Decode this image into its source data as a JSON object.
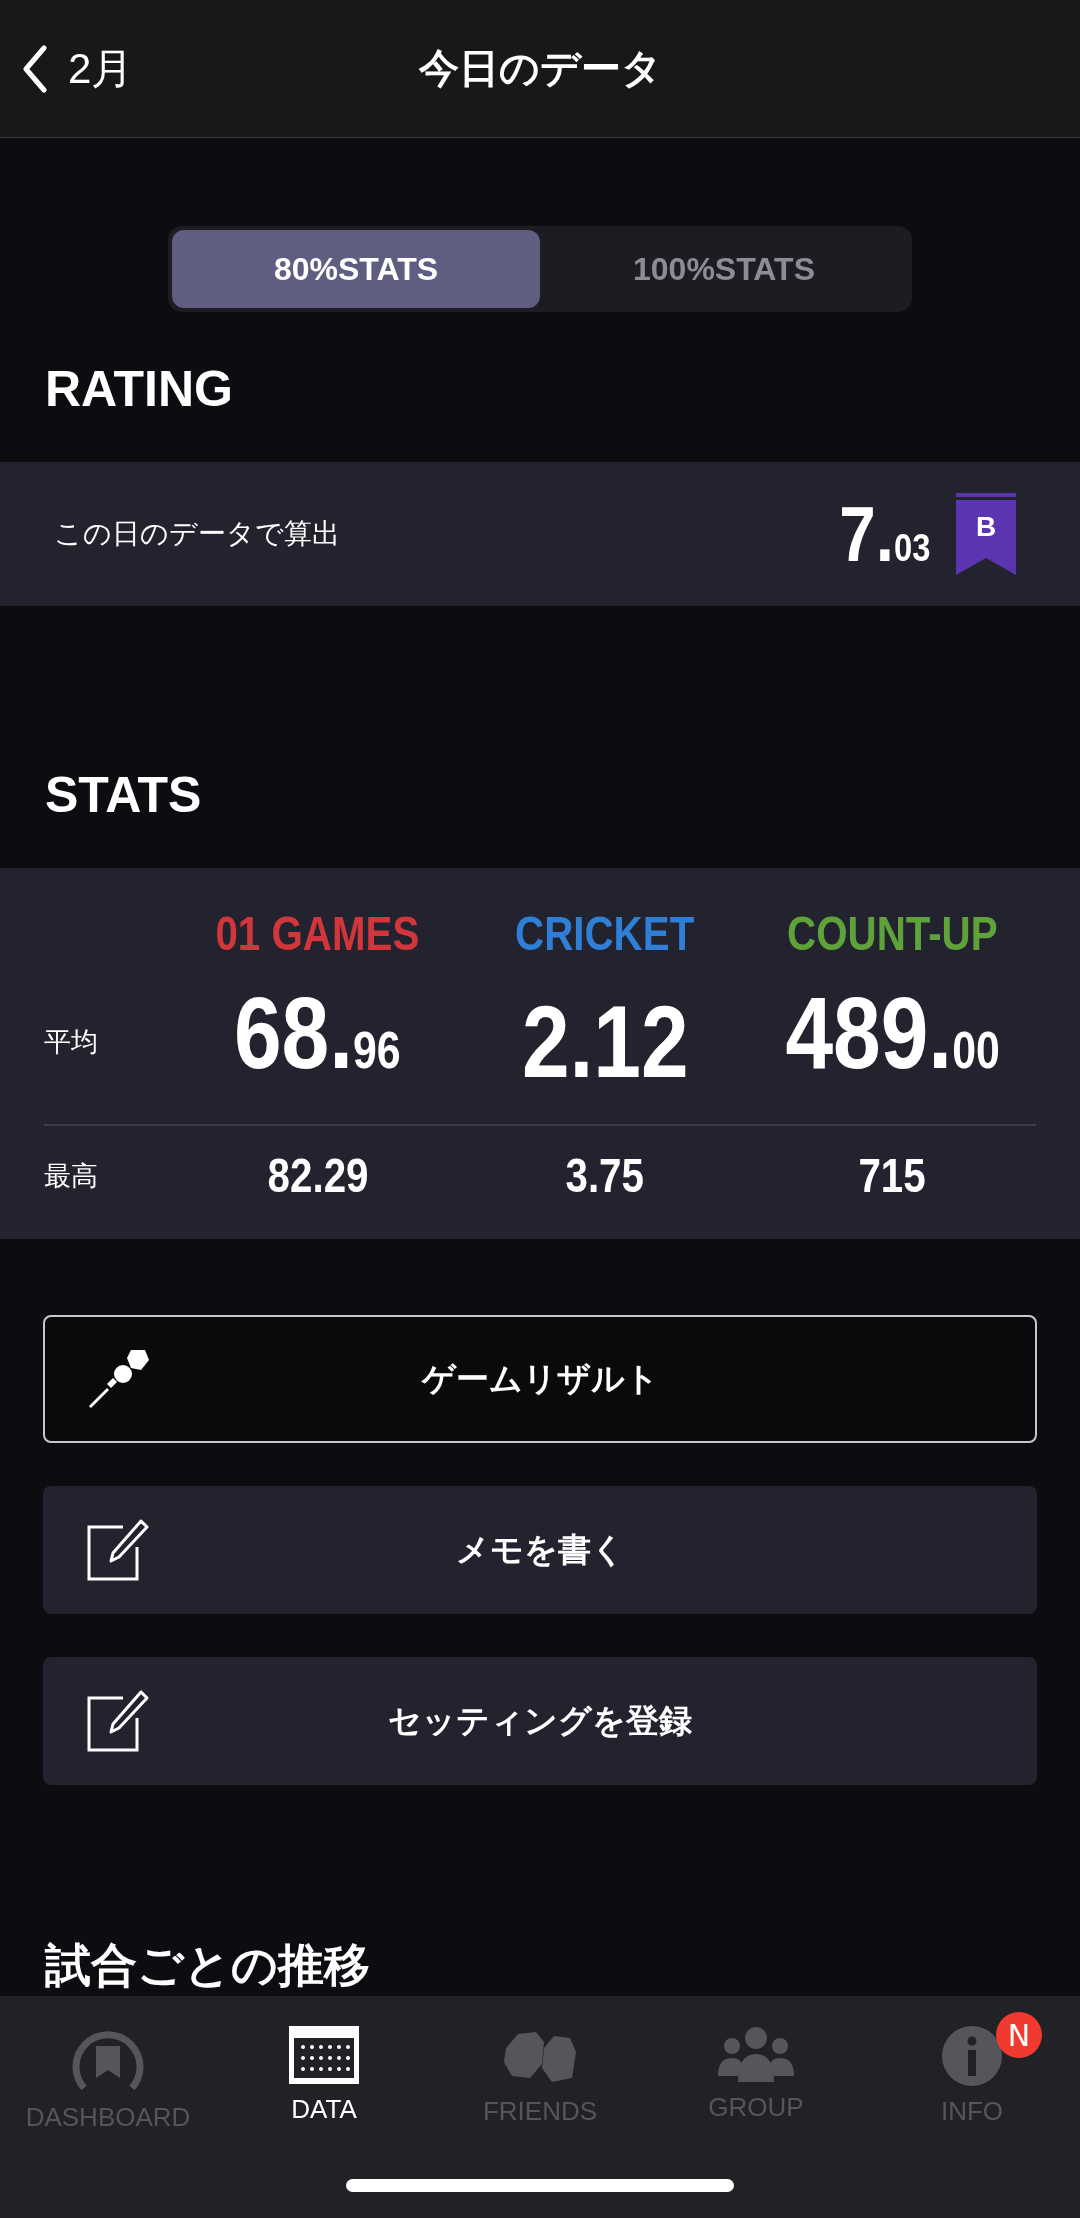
{
  "header": {
    "back_label": "2月",
    "title": "今日のデータ"
  },
  "stats_toggle": [
    {
      "label": "80%STATS",
      "selected": true
    },
    {
      "label": "100%STATS",
      "selected": false
    }
  ],
  "rating": {
    "heading": "RATING",
    "caption": "この日のデータで算出",
    "value_main": "7.",
    "value_fraction": "03",
    "rank": "B"
  },
  "stats": {
    "heading": "STATS",
    "row_labels": [
      "平均",
      "最高"
    ],
    "columns": [
      {
        "name": "01 GAMES",
        "color": "#d0363a",
        "average_main": "68.",
        "average_fraction": "96",
        "best": "82.29"
      },
      {
        "name": "CRICKET",
        "color": "#2f7fd6",
        "average_main": "2.12",
        "best": "3.75"
      },
      {
        "name": "COUNT-UP",
        "color": "#5fa23a",
        "average_main": "489.",
        "average_fraction": "00",
        "best": "715"
      }
    ]
  },
  "actions": [
    {
      "label": "ゲームリザルト",
      "kind": "outlined"
    },
    {
      "label": "メモを書く",
      "kind": "filled"
    },
    {
      "label": "セッティングを登録",
      "kind": "filled"
    }
  ],
  "section_heading": "試合ごとの推移",
  "tab_bar": [
    {
      "label": "DASHBOARD",
      "selected": false
    },
    {
      "label": "DATA",
      "selected": true
    },
    {
      "label": "FRIENDS",
      "selected": false
    },
    {
      "label": "GROUP",
      "selected": false
    },
    {
      "label": "INFO",
      "selected": false,
      "badge": "N"
    }
  ]
}
